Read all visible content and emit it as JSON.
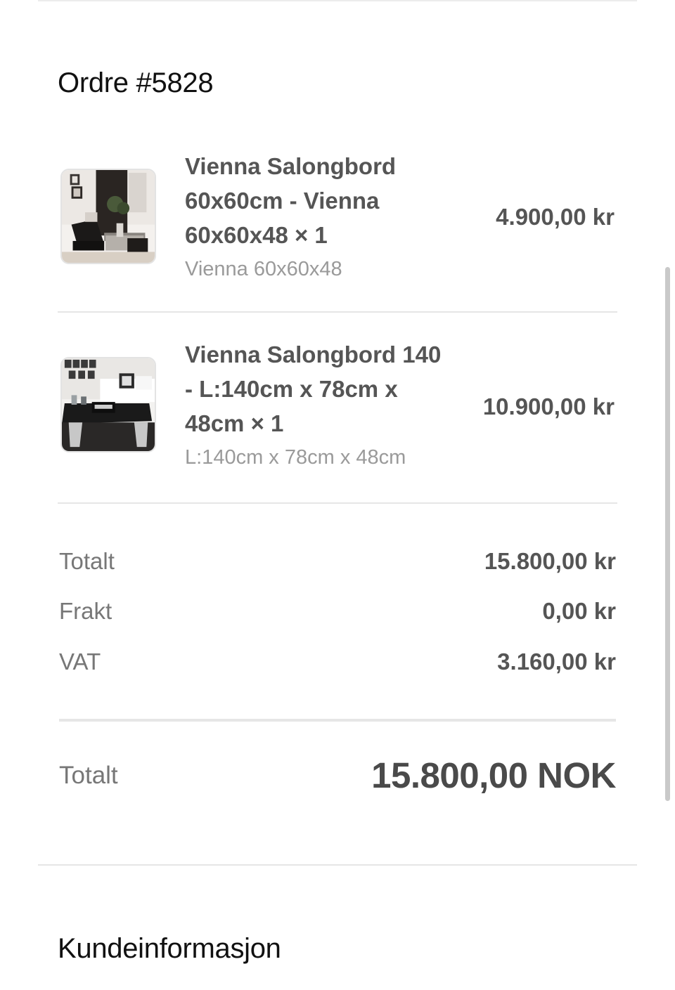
{
  "order": {
    "title": "Ordre #5828",
    "items": [
      {
        "title": "Vienna Salongbord 60x60cm - Vienna 60x60x48 × 1",
        "variant": "Vienna 60x60x48",
        "price": "4.900,00 kr",
        "image_icon": "product-image-living-room-armchair"
      },
      {
        "title": "Vienna Salongbord 140 - L:140cm x 78cm x 48cm × 1",
        "variant": "L:140cm x 78cm x 48cm",
        "price": "10.900,00 kr",
        "image_icon": "product-image-black-coffee-table"
      }
    ]
  },
  "summary": {
    "subtotal_label": "Totalt",
    "subtotal_value": "15.800,00 kr",
    "shipping_label": "Frakt",
    "shipping_value": "0,00 kr",
    "vat_label": "VAT",
    "vat_value": "3.160,00 kr"
  },
  "total": {
    "label": "Totalt",
    "value": "15.800,00 NOK"
  },
  "customer": {
    "title": "Kundeinformasjon"
  }
}
